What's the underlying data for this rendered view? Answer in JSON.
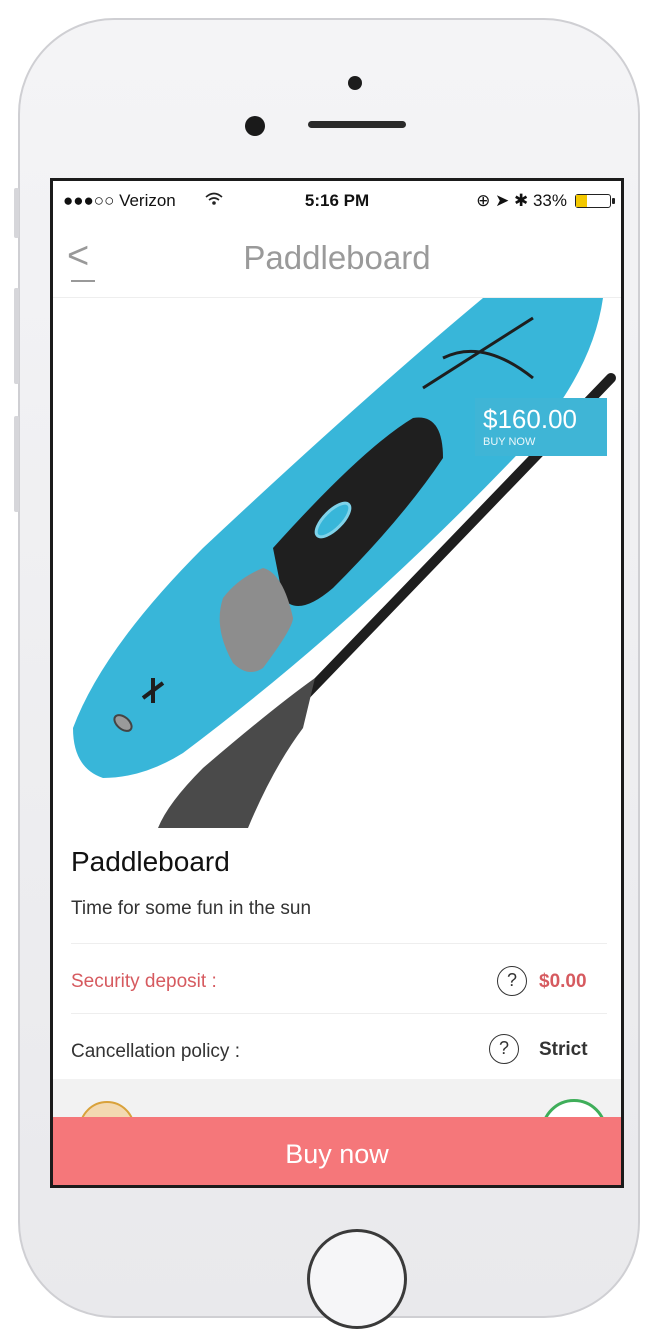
{
  "status_bar": {
    "carrier": "●●●○○ Verizon ",
    "wifi": "wifi-icon",
    "time": "5:16 PM",
    "right_icons": "⊕ ➤ ✱ 33%",
    "battery_level_percent": 33
  },
  "nav": {
    "back_icon": "back-chevron-icon",
    "back_symbol": "<",
    "title": "Paddleboard"
  },
  "product": {
    "price": "$160.00",
    "price_sub": "BUY NOW",
    "name": "Paddleboard",
    "tagline": "Time for some fun in the sun"
  },
  "details": [
    {
      "label": "Security deposit :",
      "help": "?",
      "value": "$0.00",
      "color": "#d65a5f"
    },
    {
      "label": "Cancellation policy :",
      "help": "?",
      "value": "Strict",
      "color": "#333333"
    }
  ],
  "cta": {
    "label": "Buy now"
  },
  "colors": {
    "accent_red": "#f5777a",
    "price_blue": "#3fb5d6",
    "board_blue": "#38b6d9"
  }
}
